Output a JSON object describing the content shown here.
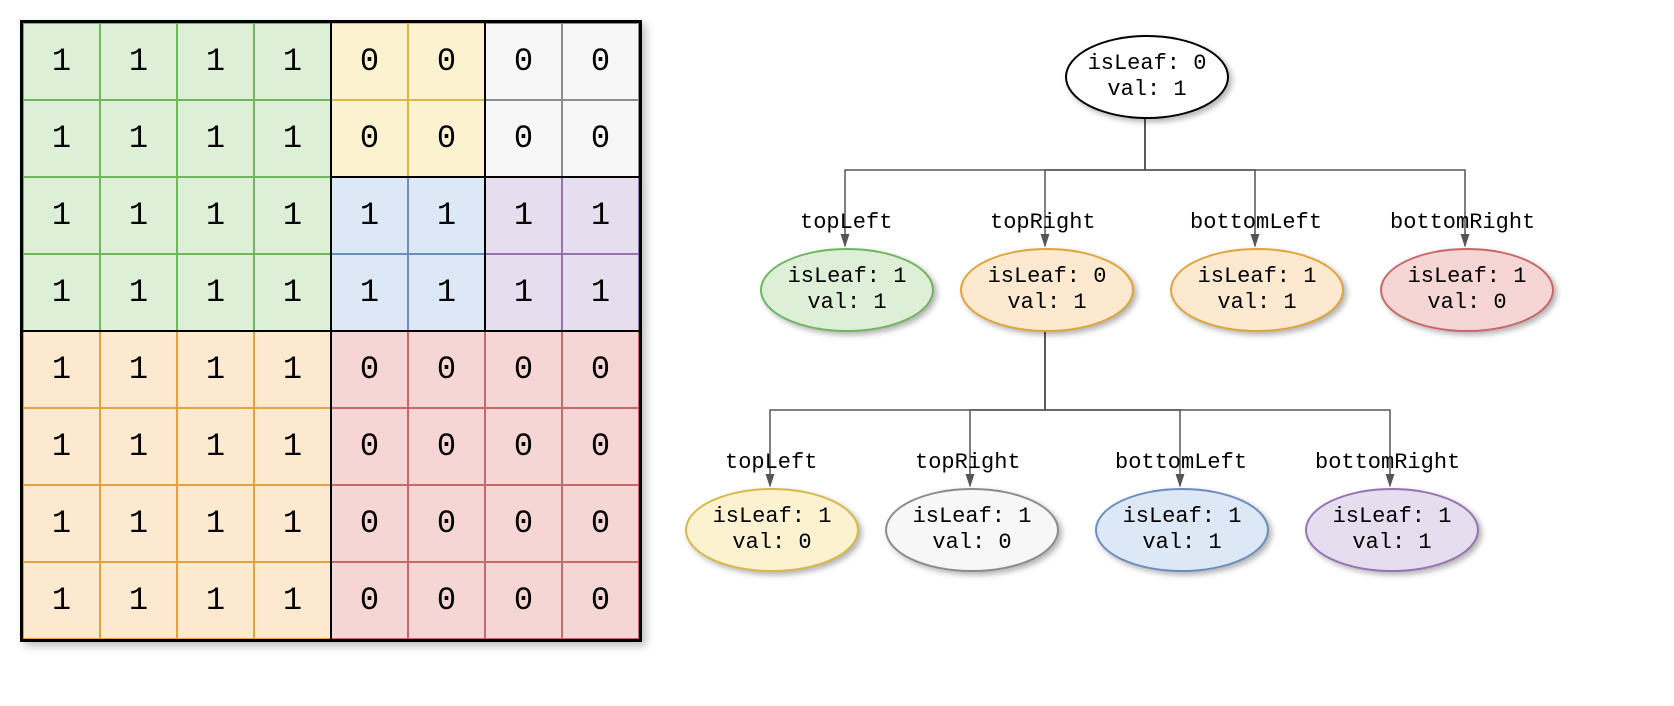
{
  "grid": {
    "size": 8,
    "values": [
      [
        1,
        1,
        1,
        1,
        0,
        0,
        0,
        0
      ],
      [
        1,
        1,
        1,
        1,
        0,
        0,
        0,
        0
      ],
      [
        1,
        1,
        1,
        1,
        1,
        1,
        1,
        1
      ],
      [
        1,
        1,
        1,
        1,
        1,
        1,
        1,
        1
      ],
      [
        1,
        1,
        1,
        1,
        0,
        0,
        0,
        0
      ],
      [
        1,
        1,
        1,
        1,
        0,
        0,
        0,
        0
      ],
      [
        1,
        1,
        1,
        1,
        0,
        0,
        0,
        0
      ],
      [
        1,
        1,
        1,
        1,
        0,
        0,
        0,
        0
      ]
    ],
    "regions": [
      {
        "name": "top-left-4x4",
        "r0": 0,
        "c0": 0,
        "r1": 3,
        "c1": 3,
        "fill": "#DDF0D7",
        "stroke": "#70B55F"
      },
      {
        "name": "bottom-left-4x4",
        "r0": 4,
        "c0": 0,
        "r1": 7,
        "c1": 3,
        "fill": "#FCE9CF",
        "stroke": "#E2A33A"
      },
      {
        "name": "bottom-right-4x4",
        "r0": 4,
        "c0": 4,
        "r1": 7,
        "c1": 7,
        "fill": "#F6D5D5",
        "stroke": "#C96868"
      },
      {
        "name": "tr-tl-2x2",
        "r0": 0,
        "c0": 4,
        "r1": 1,
        "c1": 5,
        "fill": "#FDF2D0",
        "stroke": "#D9B84A"
      },
      {
        "name": "tr-tr-2x2",
        "r0": 0,
        "c0": 6,
        "r1": 1,
        "c1": 7,
        "fill": "#F7F7F7",
        "stroke": "#8C8C8C"
      },
      {
        "name": "tr-bl-2x2",
        "r0": 2,
        "c0": 4,
        "r1": 3,
        "c1": 5,
        "fill": "#DDE8F7",
        "stroke": "#6C8EBF"
      },
      {
        "name": "tr-br-2x2",
        "r0": 2,
        "c0": 6,
        "r1": 3,
        "c1": 7,
        "fill": "#E6DDEE",
        "stroke": "#9673B2"
      }
    ]
  },
  "tree": {
    "edge_labels": [
      "topLeft",
      "topRight",
      "bottomLeft",
      "bottomRight"
    ],
    "nodes": {
      "root": {
        "isLeaf": 0,
        "val": 1,
        "fill": "#FFFFFF",
        "stroke": "#000000"
      },
      "l1_0": {
        "isLeaf": 1,
        "val": 1,
        "fill": "#DDF0D7",
        "stroke": "#70B55F"
      },
      "l1_1": {
        "isLeaf": 0,
        "val": 1,
        "fill": "#FCE9CF",
        "stroke": "#E2A33A"
      },
      "l1_2": {
        "isLeaf": 1,
        "val": 1,
        "fill": "#FCE9CF",
        "stroke": "#E2A33A"
      },
      "l1_3": {
        "isLeaf": 1,
        "val": 0,
        "fill": "#F6D5D5",
        "stroke": "#C96868"
      },
      "l2_0": {
        "isLeaf": 1,
        "val": 0,
        "fill": "#FDF2D0",
        "stroke": "#D9B84A"
      },
      "l2_1": {
        "isLeaf": 1,
        "val": 0,
        "fill": "#F7F7F7",
        "stroke": "#8C8C8C"
      },
      "l2_2": {
        "isLeaf": 1,
        "val": 1,
        "fill": "#DDE8F7",
        "stroke": "#6C8EBF"
      },
      "l2_3": {
        "isLeaf": 1,
        "val": 1,
        "fill": "#E6DDEE",
        "stroke": "#9673B2"
      }
    },
    "labels": {
      "isLeaf": "isLeaf:",
      "val": "val:"
    }
  }
}
